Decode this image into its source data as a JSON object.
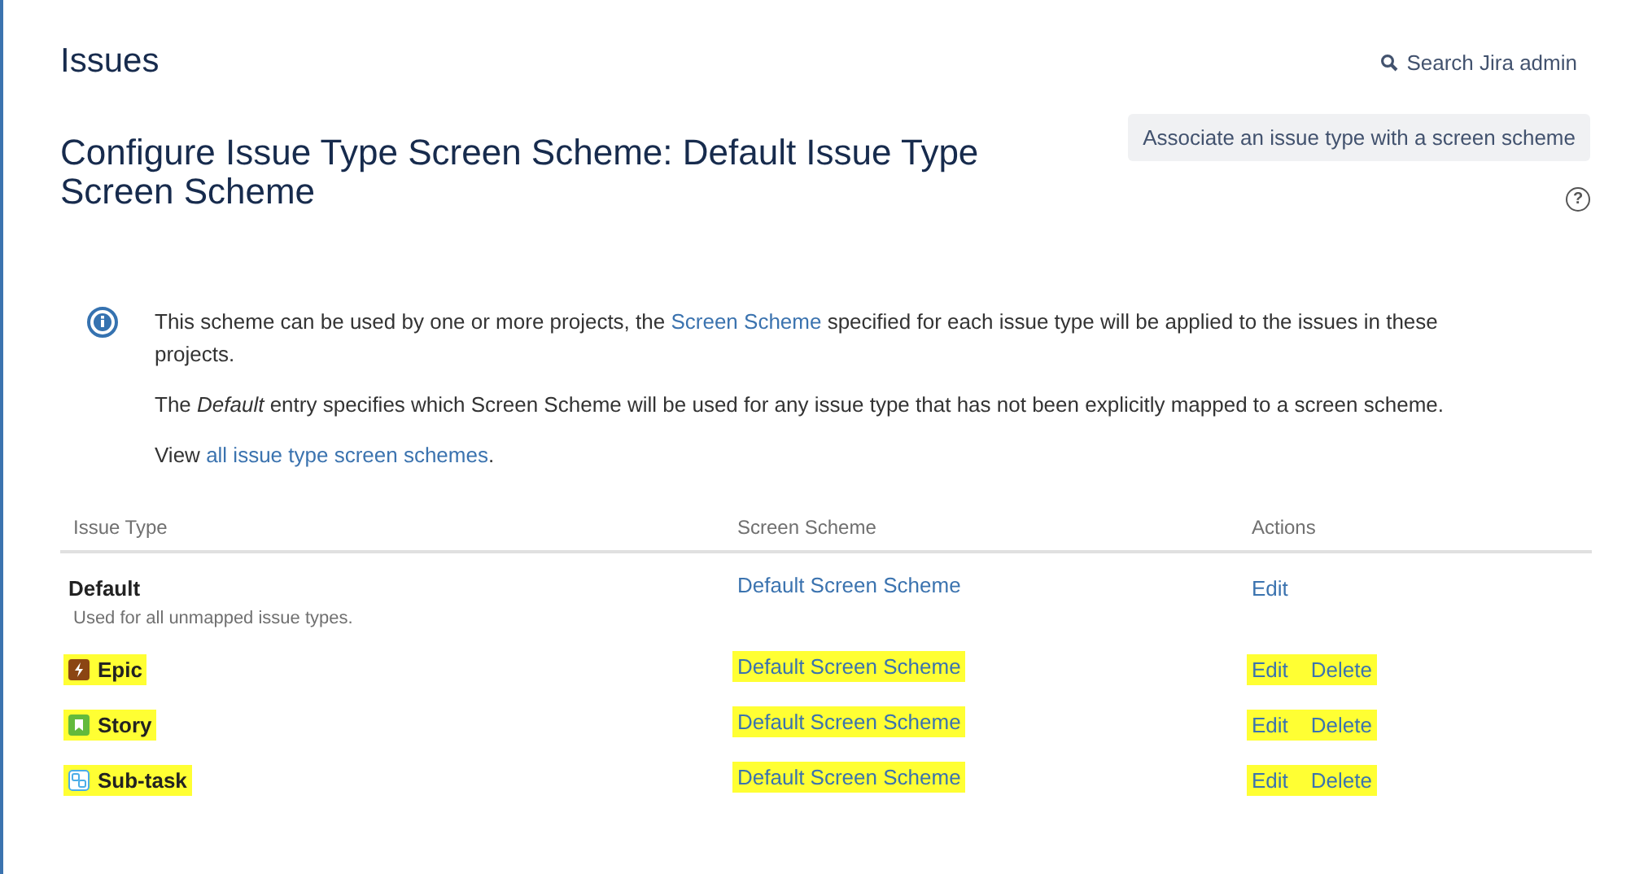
{
  "header": {
    "title": "Issues",
    "search": "Search Jira admin"
  },
  "page": {
    "title": "Configure Issue Type Screen Scheme: Default Issue Type Screen Scheme",
    "button": "Associate an issue type with a screen scheme",
    "help": "?"
  },
  "info": {
    "paragraphs": [
      [
        {
          "text": "This scheme can be used by one or more projects, the ",
          "kind": "text"
        },
        {
          "text": "Screen Scheme",
          "kind": "link"
        },
        {
          "text": " specified for each issue type will be applied to the issues in these projects.",
          "kind": "text"
        }
      ],
      [
        {
          "text": "The *Default* entry specifies which Screen Scheme will be used for any issue type that has not been explicitly mapped to a screen scheme.",
          "kind": "text"
        }
      ],
      [
        {
          "text": "View ",
          "kind": "text"
        },
        {
          "text": "all issue type screen schemes",
          "kind": "link"
        },
        {
          "text": ".",
          "kind": "text"
        }
      ]
    ]
  },
  "table": {
    "columns": [
      "Issue Type",
      "Screen Scheme",
      "Actions"
    ],
    "rows": [
      {
        "issue_type": "Default",
        "kind": "default",
        "description": "Used for all unmapped issue types.",
        "screen_scheme": "Default Screen Scheme",
        "actions": [
          "Edit"
        ],
        "highlighted": false
      },
      {
        "issue_type": "Epic",
        "kind": "epic",
        "screen_scheme": "Default Screen Scheme",
        "actions": [
          "Edit",
          "Delete"
        ],
        "highlighted": true
      },
      {
        "issue_type": "Story",
        "kind": "story",
        "screen_scheme": "Default Screen Scheme",
        "actions": [
          "Edit",
          "Delete"
        ],
        "highlighted": true
      },
      {
        "issue_type": "Sub-task",
        "kind": "subtask",
        "screen_scheme": "Default Screen Scheme",
        "actions": [
          "Edit",
          "Delete"
        ],
        "highlighted": true
      }
    ]
  }
}
